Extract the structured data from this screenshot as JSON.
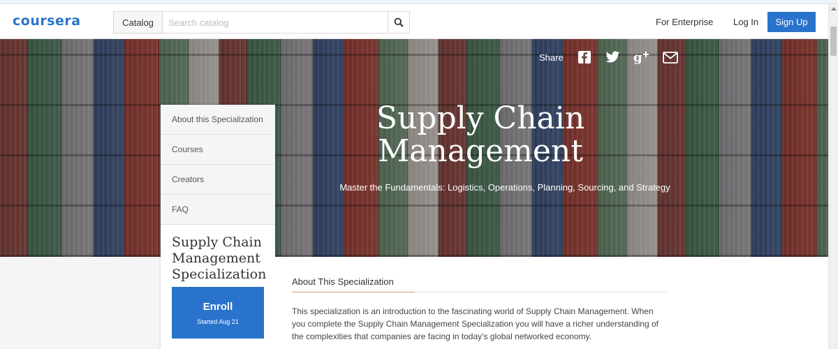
{
  "header": {
    "logo": "coursera",
    "catalog_label": "Catalog",
    "search_placeholder": "Search catalog",
    "for_enterprise": "For Enterprise",
    "login": "Log In",
    "signup": "Sign Up"
  },
  "hero": {
    "share_label": "Share",
    "share_icons": [
      "facebook-icon",
      "twitter-icon",
      "google-plus-icon",
      "email-icon"
    ],
    "title": "Supply Chain Management",
    "subtitle": "Master the Fundamentals: Logistics, Operations, Planning, Sourcing, and Strategy"
  },
  "side_nav": {
    "items": [
      {
        "label": "About this Specialization"
      },
      {
        "label": "Courses"
      },
      {
        "label": "Creators"
      },
      {
        "label": "FAQ"
      }
    ],
    "course_title": "Supply Chain Management Specialization",
    "enroll_label": "Enroll",
    "enroll_sub": "Started Aug 21"
  },
  "main": {
    "heading": "About This Specialization",
    "body": "This specialization is an introduction to the fascinating world of Supply Chain Management. When you complete the Supply Chain Management Specialization you will have a richer understanding of the complexities that companies are facing in today's global networked economy."
  },
  "colors": {
    "brand": "#2a73cc",
    "accent_line": "#d09a86"
  }
}
